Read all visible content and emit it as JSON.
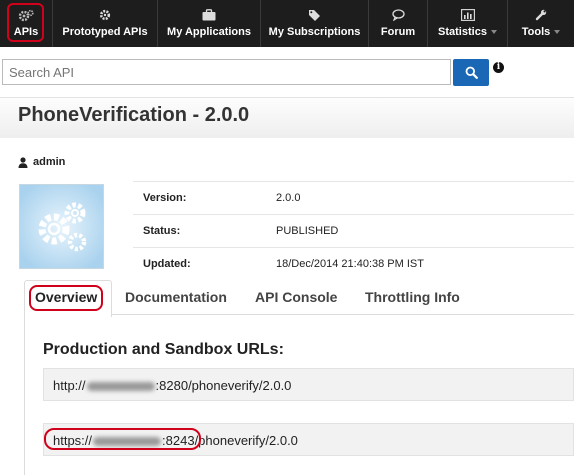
{
  "nav": {
    "items": [
      {
        "label": "APIs",
        "icon": "gears-icon",
        "dropdown": false
      },
      {
        "label": "Prototyped APIs",
        "icon": "gear-icon",
        "dropdown": false
      },
      {
        "label": "My Applications",
        "icon": "briefcase-icon",
        "dropdown": false
      },
      {
        "label": "My Subscriptions",
        "icon": "tags-icon",
        "dropdown": false
      },
      {
        "label": "Forum",
        "icon": "chat-bubble-icon",
        "dropdown": false
      },
      {
        "label": "Statistics",
        "icon": "bar-chart-icon",
        "dropdown": true
      },
      {
        "label": "Tools",
        "icon": "wrench-icon",
        "dropdown": true
      }
    ]
  },
  "search": {
    "placeholder": "Search API"
  },
  "api": {
    "title": "PhoneVerification - 2.0.0",
    "owner": "admin",
    "meta": [
      {
        "key": "Version:",
        "value": "2.0.0"
      },
      {
        "key": "Status:",
        "value": "PUBLISHED"
      },
      {
        "key": "Updated:",
        "value": "18/Dec/2014 21:40:38 PM IST"
      }
    ]
  },
  "tabs": [
    {
      "label": "Overview",
      "active": true
    },
    {
      "label": "Documentation",
      "active": false
    },
    {
      "label": "API Console",
      "active": false
    },
    {
      "label": "Throttling Info",
      "active": false
    }
  ],
  "overview": {
    "section_title": "Production and Sandbox URLs:",
    "urls": [
      {
        "prefix": "http://",
        "suffix": ":8280/phoneverify/2.0.0"
      },
      {
        "prefix": "https://",
        "suffix": ":8243/phoneverify/2.0.0"
      }
    ]
  },
  "colors": {
    "navbar": "#1d1d1d",
    "highlight": "#d0021b",
    "search_button": "#1a68b5"
  }
}
